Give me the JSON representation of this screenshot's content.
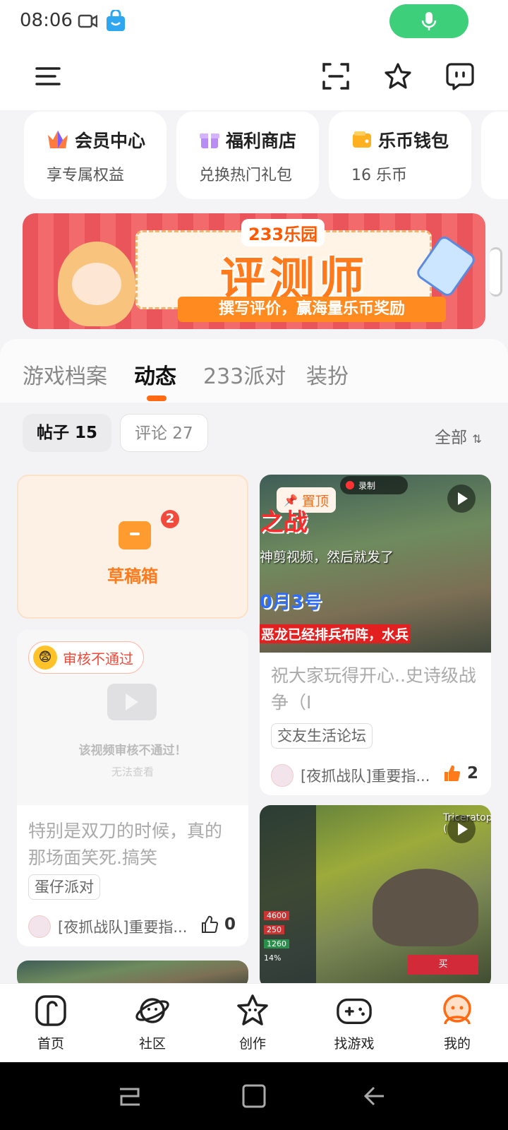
{
  "status": {
    "time": "08:06"
  },
  "quick_cards": [
    {
      "title": "会员中心",
      "sub": "享专属权益"
    },
    {
      "title": "福利商店",
      "sub": "兑换热门礼包"
    },
    {
      "title": "乐币钱包",
      "sub": "16 乐币"
    }
  ],
  "banner": {
    "brand": "233乐园",
    "headline": "评测师",
    "tagline": "撰写评价，赢海量乐币奖励"
  },
  "tabs": [
    "游戏档案",
    "动态",
    "233派对",
    "装扮"
  ],
  "filters": {
    "posts": "帖子 15",
    "comments": "评论 27",
    "all": "全部"
  },
  "draft": {
    "label": "草稿箱",
    "count": "2"
  },
  "posts": [
    {
      "pinned": "置顶",
      "record_label": "录制",
      "overlay_lines": [
        "之战",
        "神剪视频，然后就发了",
        "0月3号",
        "恶龙已经排兵布阵，水兵"
      ],
      "title": "祝大家玩得开心..史诗级战争（I",
      "tag": "交友生活论坛",
      "user": "[夜抓战队]重要指...",
      "likes": "2"
    },
    {
      "review_badge": "审核不通过",
      "review_msg": "该视频审核不通过！",
      "review_sub": "无法查看",
      "title": "特别是双刀的时候，真的那场面笑死.搞笑",
      "tag": "蛋仔派对",
      "user": "[夜抓战队]重要指...",
      "likes": "0"
    },
    {
      "overlay_title": "Triceratops (",
      "action": "买",
      "stats": [
        "4600",
        "250",
        "1260",
        "14%"
      ]
    }
  ],
  "bottom_nav": [
    "首页",
    "社区",
    "创作",
    "找游戏",
    "我的"
  ],
  "colors": {
    "accent": "#ff6a13",
    "mic": "#3ecf7a"
  }
}
